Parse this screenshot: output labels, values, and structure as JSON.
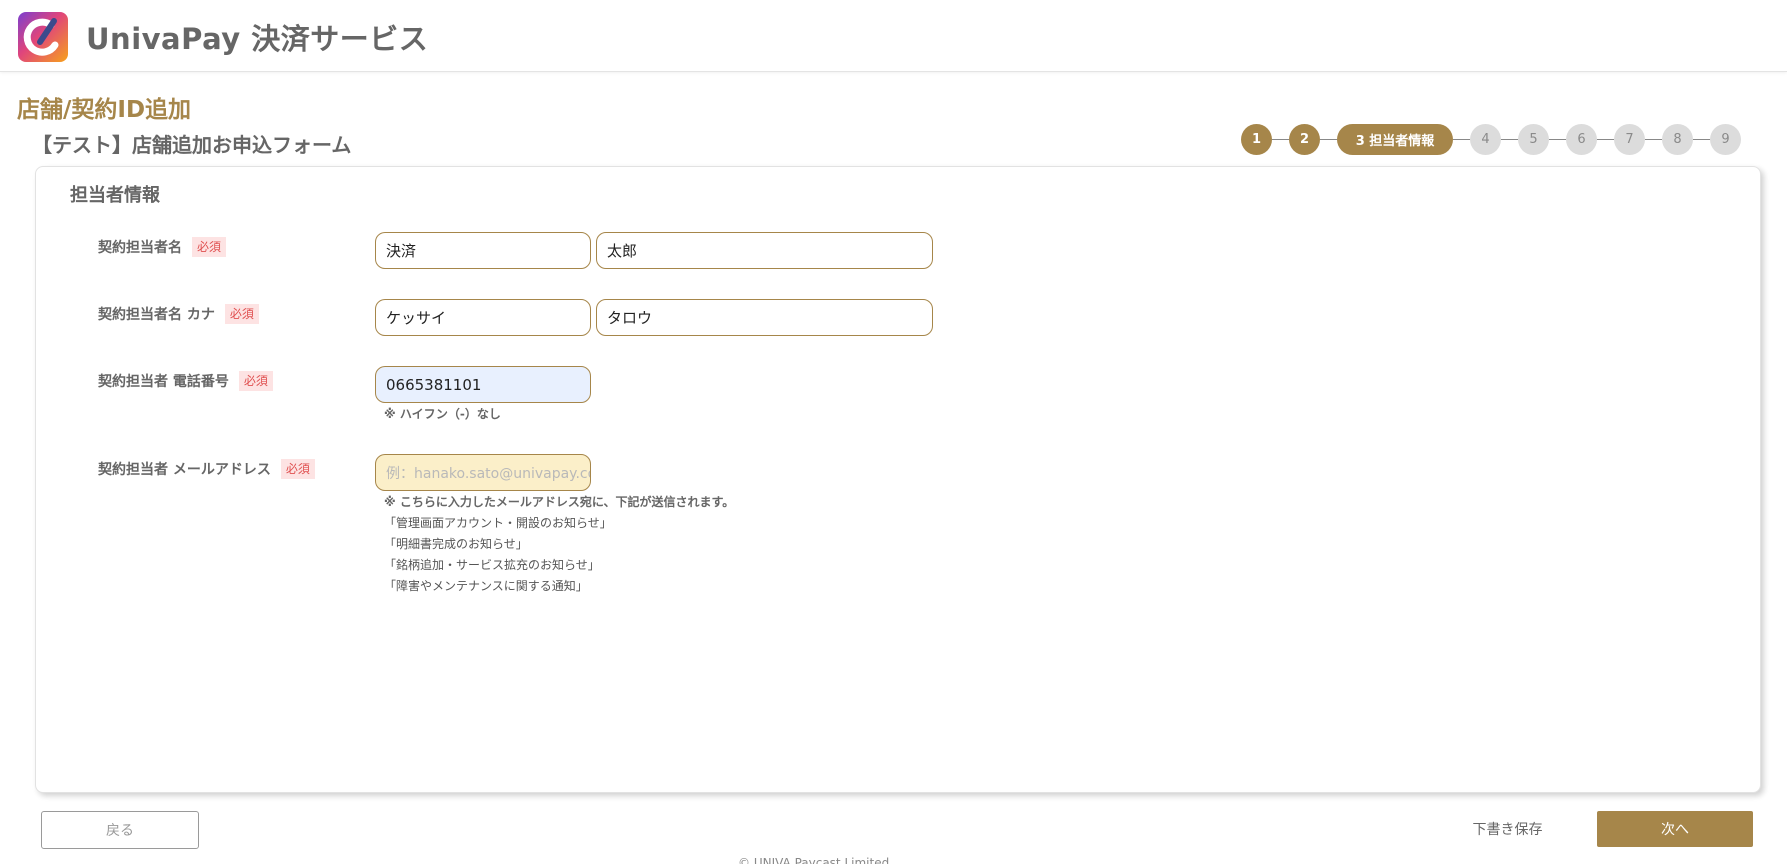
{
  "header": {
    "app_title": "UnivaPay 決済サービス",
    "logo_icon": "univapay-logo-icon"
  },
  "page": {
    "title": "店舗/契約ID追加",
    "form_title": "【テスト】店舗追加お申込フォーム"
  },
  "stepper": {
    "steps": [
      "1",
      "2",
      "3 担当者情報",
      "4",
      "5",
      "6",
      "7",
      "8",
      "9"
    ],
    "current_step": 3,
    "accent_color": "#a6864a",
    "inactive_color": "#dcdcdc"
  },
  "section": {
    "title": "担当者情報",
    "required_badge": "必須",
    "fields": {
      "name": {
        "label": "契約担当者名",
        "last_name": "決済",
        "first_name": "太郎"
      },
      "kana": {
        "label": "契約担当者名 カナ",
        "last_name": "ケッサイ",
        "first_name": "タロウ"
      },
      "phone": {
        "label": "契約担当者 電話番号",
        "value": "0665381101",
        "hint": "※ ハイフン（-）なし"
      },
      "email": {
        "label": "契約担当者 メールアドレス",
        "placeholder": "例：hanako.sato@univapay.com",
        "hint_intro": "※ こちらに入力したメールアドレス宛に、下記が送信されます。",
        "hint_items": [
          "「管理画面アカウント・開設のお知らせ」",
          "「明細書完成のお知らせ」",
          "「銘柄追加・サービス拡充のお知らせ」",
          "「障害やメンテナンスに関する通知」"
        ]
      }
    }
  },
  "actions": {
    "back_label": "戻る",
    "draft_label": "下書き保存",
    "next_label": "次へ"
  },
  "footer": {
    "copyright": "© UNIVA Paycast Limited"
  }
}
